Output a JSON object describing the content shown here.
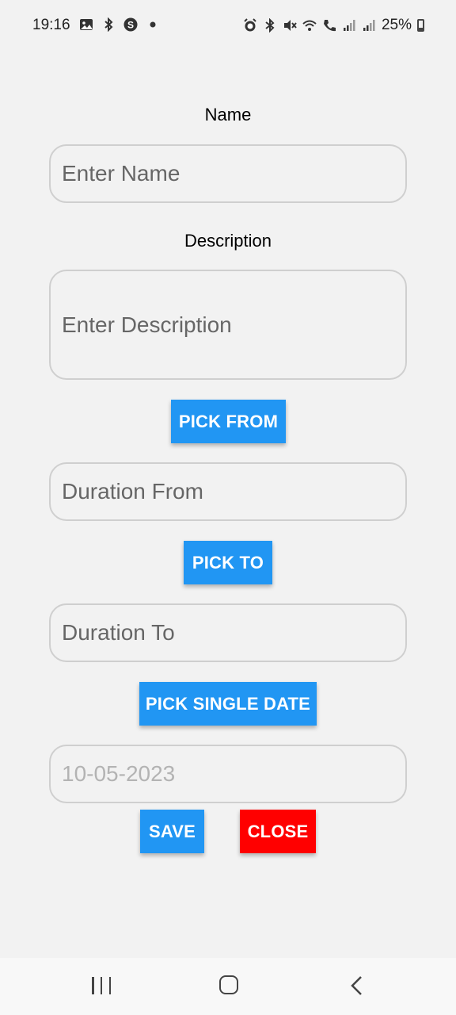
{
  "status_bar": {
    "time": "19:16",
    "battery": "25%",
    "left_icons": [
      "gallery-icon",
      "bluetooth-icon",
      "skype-icon",
      "dot-icon"
    ],
    "right_icons": [
      "alarm-icon",
      "bluetooth-icon",
      "mute-icon",
      "wifi-icon",
      "call-icon",
      "signal-icon",
      "signal-icon",
      "battery-icon"
    ]
  },
  "form": {
    "name_label": "Name",
    "name_placeholder": "Enter Name",
    "description_label": "Description",
    "description_placeholder": "Enter Description",
    "pick_from_label": "PICK FROM",
    "duration_from_placeholder": "Duration From",
    "pick_to_label": "PICK TO",
    "duration_to_placeholder": "Duration To",
    "pick_single_date_label": "PICK SINGLE DATE",
    "single_date_value": "10-05-2023",
    "save_label": "SAVE",
    "close_label": "CLOSE"
  },
  "colors": {
    "primary_button": "#2196f3",
    "close_button": "#ff0000",
    "background": "#f2f2f2"
  },
  "nav_bar": {
    "icons": [
      "recent-apps-icon",
      "home-icon",
      "back-icon"
    ]
  }
}
